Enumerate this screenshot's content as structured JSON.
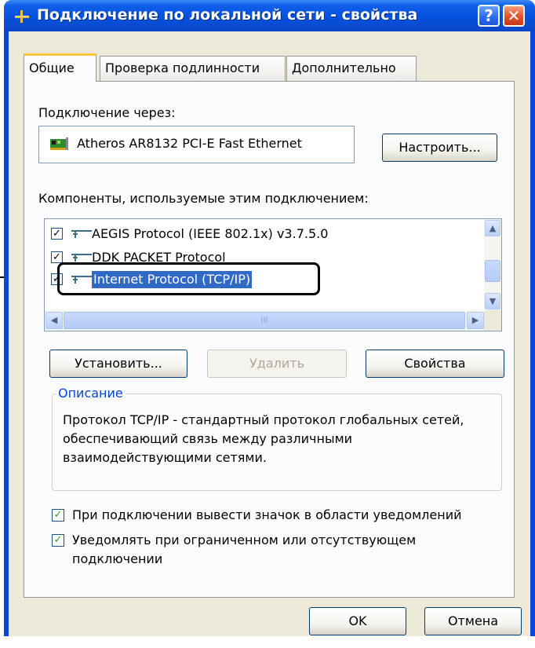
{
  "window": {
    "title": "Подключение по локальной сети - свойства",
    "help_label": "?",
    "close_label": "✕"
  },
  "tabs": [
    {
      "label": "Общие",
      "active": true
    },
    {
      "label": "Проверка подлинности",
      "active": false
    },
    {
      "label": "Дополнительно",
      "active": false
    }
  ],
  "connect_via": {
    "label": "Подключение через:",
    "adapter": "Atheros AR8132 PCI-E Fast Ethernet",
    "adapter_icon": "network-card-icon",
    "configure_button": "Настроить..."
  },
  "components": {
    "label": "Компоненты, используемые этим подключением:",
    "items": [
      {
        "label": "AEGIS Protocol (IEEE 802.1x) v3.7.5.0",
        "checked": true,
        "selected": false
      },
      {
        "label": "DDK PACKET Protocol",
        "checked": true,
        "selected": false
      },
      {
        "label": "Internet Protocol (TCP/IP)",
        "checked": true,
        "selected": true
      }
    ],
    "scroll_grip": "III"
  },
  "buttons": {
    "install": "Установить...",
    "remove": "Удалить",
    "properties": "Свойства",
    "ok": "OK",
    "cancel": "Отмена"
  },
  "description": {
    "legend": "Описание",
    "text": "Протокол TCP/IP - стандартный протокол глобальных сетей, обеспечивающий связь между различными взаимодействующими сетями."
  },
  "options": [
    {
      "label": "При подключении вывести значок в области уведомлений",
      "checked": true
    },
    {
      "label": "Уведомлять при ограниченном или отсутствующем подключении",
      "checked": true
    }
  ],
  "colors": {
    "title_bar": "#0552e0",
    "selection": "#316ac5",
    "legend": "#0046d5",
    "checkmark": "#21a121"
  }
}
